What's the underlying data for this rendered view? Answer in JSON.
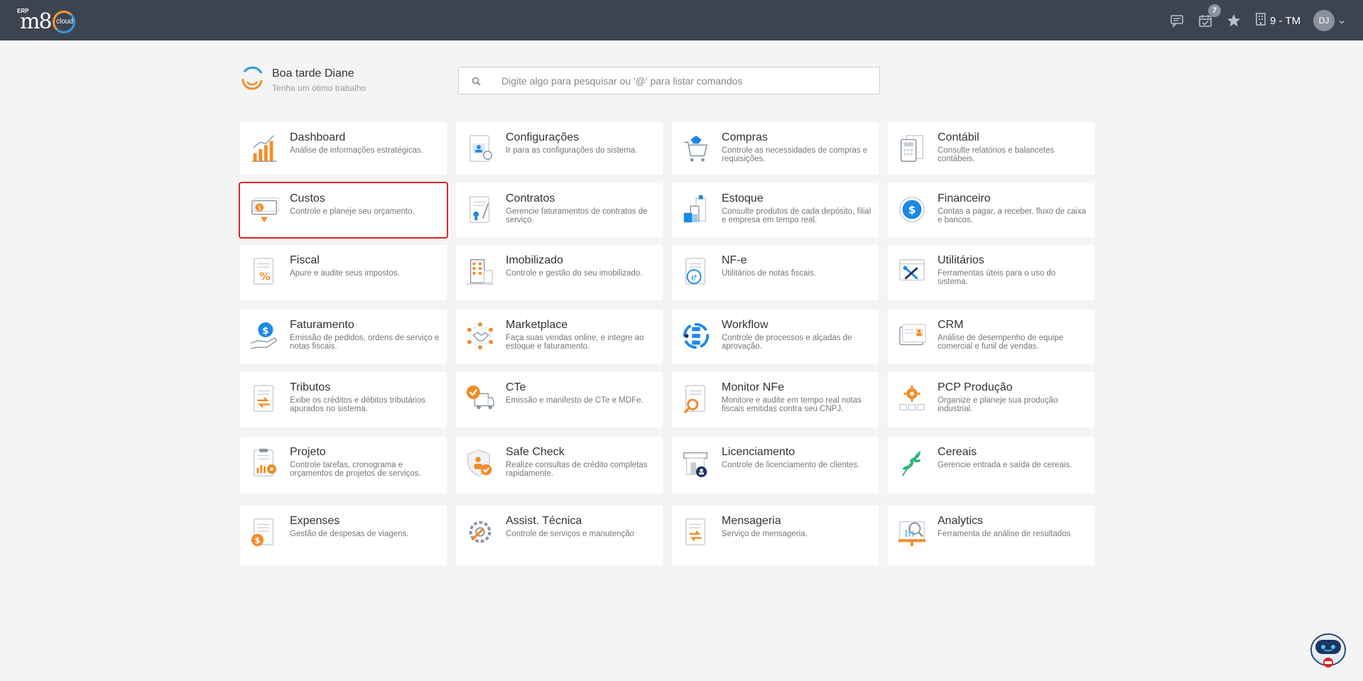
{
  "header": {
    "logo_erp": "ERP",
    "logo_m8": "m8",
    "logo_cloud": "cloud",
    "calendar_badge": "7",
    "branch_label": "9 - TM",
    "avatar_initials": "DJ",
    "icons": [
      "chat-icon",
      "calendar-icon",
      "star-icon",
      "building-icon",
      "chevron-down-icon"
    ]
  },
  "greeting": {
    "title": "Boa tarde Diane",
    "subtitle": "Tenha um ótimo trabalho"
  },
  "search": {
    "placeholder": "Digite algo para pesquisar ou '@' para listar comandos"
  },
  "colors": {
    "topbar": "#3d4451",
    "accent_orange": "#f28c28",
    "accent_blue": "#1e88e5",
    "highlight": "#e02424"
  },
  "modules": [
    {
      "title": "Dashboard",
      "desc": "Análise de informações estratégicas.",
      "icon": "bar-chart-icon"
    },
    {
      "title": "Configurações",
      "desc": "Ir para as configurações do sistema.",
      "icon": "settings-profile-icon"
    },
    {
      "title": "Compras",
      "desc": "Controle as necessidades de compras e requisições.",
      "icon": "shopping-cart-icon"
    },
    {
      "title": "Contábil",
      "desc": "Consulte relatórios e balancetes contábeis.",
      "icon": "calculator-icon"
    },
    {
      "title": "Custos",
      "desc": "Controle e planeje seu orçamento.",
      "icon": "money-icon"
    },
    {
      "title": "Contratos",
      "desc": "Gerencie faturamentos de contratos de serviço.",
      "icon": "contract-icon"
    },
    {
      "title": "Estoque",
      "desc": "Consulte produtos de cada depósito, filial e empresa em tempo real.",
      "icon": "boxes-icon"
    },
    {
      "title": "Financeiro",
      "desc": "Contas a pagar, a receber, fluxo de caixa e bancos.",
      "icon": "dollar-circle-icon"
    },
    {
      "title": "Fiscal",
      "desc": "Apure e audite seus impostos.",
      "icon": "percent-document-icon"
    },
    {
      "title": "Imobilizado",
      "desc": "Controle e gestão do seu imobilizado.",
      "icon": "building-asset-icon"
    },
    {
      "title": "NF-e",
      "desc": "Utilitários de notas fiscais.",
      "icon": "nfe-document-icon"
    },
    {
      "title": "Utilitários",
      "desc": "Ferramentas úteis para o uso do sistema.",
      "icon": "tools-icon"
    },
    {
      "title": "Faturamento",
      "desc": "Emissão de pedidos, ordens de serviço e notas fiscais.",
      "icon": "hand-dollar-icon"
    },
    {
      "title": "Marketplace",
      "desc": "Faça suas vendas online, e integre ao estoque e faturamento.",
      "icon": "network-handshake-icon"
    },
    {
      "title": "Workflow",
      "desc": "Controle de processos e alçadas de aprovação.",
      "icon": "workflow-icon"
    },
    {
      "title": "CRM",
      "desc": "Análise de desempenho de equipe comercial e funil de vendas.",
      "icon": "crm-card-icon"
    },
    {
      "title": "Tributos",
      "desc": "Exibe os créditos e débitos tributários apurados no sistema.",
      "icon": "tax-exchange-icon"
    },
    {
      "title": "CTe",
      "desc": "Emissão e manifesto de CTe e MDFe.",
      "icon": "truck-check-icon"
    },
    {
      "title": "Monitor NFe",
      "desc": "Monitore e audite em tempo real notas fiscais emitidas contra seu CNPJ.",
      "icon": "magnifier-document-icon"
    },
    {
      "title": "PCP Produção",
      "desc": "Organize e planeje sua produção industrial.",
      "icon": "production-gear-icon"
    },
    {
      "title": "Projeto",
      "desc": "Controle tarefas, cronograma e orçamentos de projetos de serviços.",
      "icon": "clipboard-gear-icon"
    },
    {
      "title": "Safe Check",
      "desc": "Realize consultas de crédito completas rapidamente.",
      "icon": "shield-check-icon"
    },
    {
      "title": "Licenciamento",
      "desc": "Controle de licenciamento de clientes.",
      "icon": "license-badge-icon"
    },
    {
      "title": "Cereais",
      "desc": "Gerencie entrada e saída de cereais.",
      "icon": "wheat-icon"
    },
    {
      "title": "Expenses",
      "desc": "Gestão de despesas de viagens.",
      "icon": "expense-coin-icon"
    },
    {
      "title": "Assist. Técnica",
      "desc": "Controle de serviços e manutenção",
      "icon": "wrench-gear-icon"
    },
    {
      "title": "Mensageria",
      "desc": "Serviço de mensageria.",
      "icon": "message-exchange-icon"
    },
    {
      "title": "Analytics",
      "desc": "Ferramenta de análise de resultados",
      "icon": "analytics-screen-icon"
    }
  ]
}
